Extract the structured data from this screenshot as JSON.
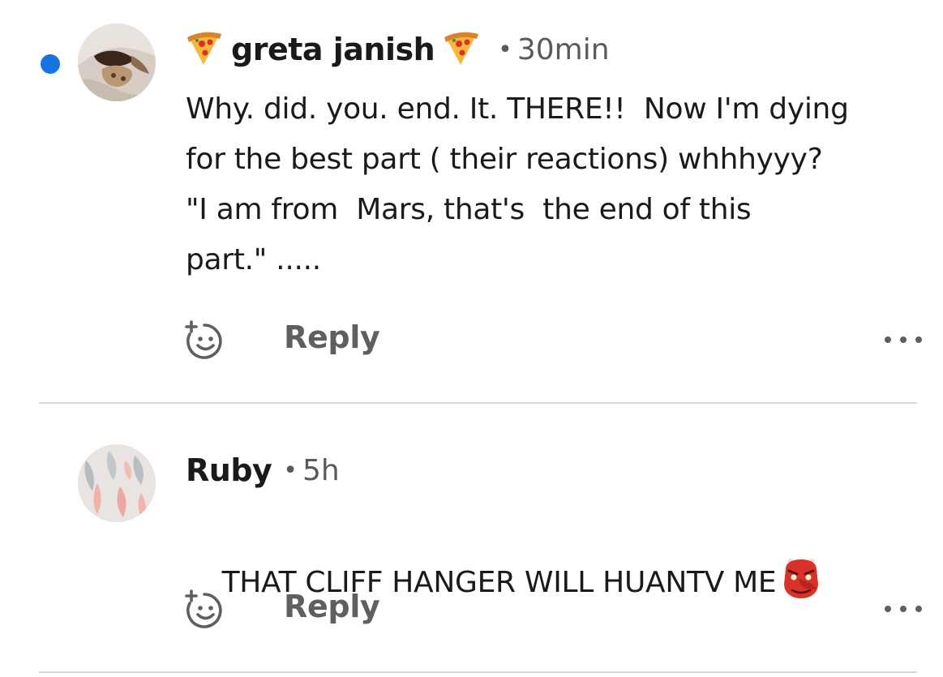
{
  "comments": [
    {
      "username": "greta janish",
      "separator": "•",
      "time": "30min",
      "unread": true,
      "text": "Why. did. you. end. It. THERE!!  Now I'm dying\nfor the best part ( their reactions) whhhyyy?\n\"I am from  Mars, that's  the end of this\npart.\" .....",
      "reply_label": "Reply",
      "name_emoji": "pizza-icon"
    },
    {
      "username": "Ruby",
      "separator": "•",
      "time": "5h",
      "unread": false,
      "text": "THAT CLIFF HANGER WILL HUANTV ME",
      "reply_label": "Reply",
      "trailing_emoji": "oni-mask-icon"
    }
  ],
  "colors": {
    "unread_dot": "#1874e0",
    "text": "#1a1a1a",
    "muted": "#5f5f5f",
    "divider": "#d9d9d9"
  }
}
